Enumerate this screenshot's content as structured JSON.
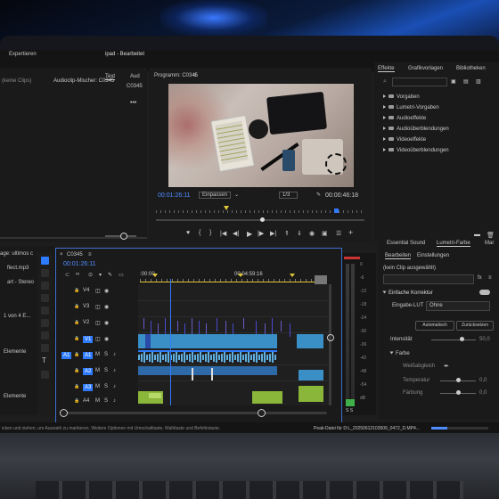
{
  "window": {
    "workspace_tabs": [
      "Expertieren",
      "ipad - Bearbeitet"
    ],
    "left_panel_hint": "(keine Clips)",
    "audio_mixer_label": "Audioclip-Mischer: C0345",
    "text_tab": "Text",
    "aud_tab": "Aud",
    "clip_name": "C0345"
  },
  "program_monitor": {
    "title": "Programm: C0345",
    "timecode_left": "00:01:26:11",
    "fit_option": "Einpassen",
    "resolution": "1/3",
    "timecode_right": "00:00:46:18"
  },
  "effects_panel": {
    "tabs": [
      "Effekte",
      "Grafikvorlagen",
      "Bibliotheken"
    ],
    "items": [
      "Vorgaben",
      "Lumetri-Vorgaben",
      "Audioeffekte",
      "Audioüberblendungen",
      "Videoeffekte",
      "Videoüberblendungen"
    ]
  },
  "timeline": {
    "sequence_name": "C0345",
    "timecode": "00:01:26:11",
    "ruler_marks": [
      ":00:00",
      "00:04:59:16"
    ],
    "video_tracks": [
      "V4",
      "V3",
      "V2",
      "V1"
    ],
    "audio_tracks": [
      "A1",
      "A2",
      "A3",
      "A4"
    ],
    "source_patch": "A1",
    "track_letters": [
      "M",
      "S"
    ]
  },
  "project_panel": {
    "items": [
      "age: ultimos c",
      "flect.mp3",
      "art - Stereo",
      "1 von 4 E...",
      "Elemente",
      "Elemente"
    ]
  },
  "lumetri": {
    "tabs": [
      "Essential Sound",
      "Lumetri-Farbe",
      "Mar"
    ],
    "subtabs": [
      "Bearbeiten",
      "Einstellungen"
    ],
    "no_clip": "(kein Clip ausgewählt)",
    "fx_label": "fx",
    "section_basic": "Einfache Korrektur",
    "input_lut_label": "Eingabe-LUT",
    "input_lut_value": "Ohne",
    "auto_button": "Automatisch",
    "reset_button": "Zurücksetzen",
    "intensity_label": "Intensität",
    "intensity_value": "50,0",
    "color_section": "Farbe",
    "white_balance": "Weißabgleich",
    "temperature": "Temperatur",
    "temperature_value": "0,0",
    "tint": "Färbung",
    "tint_value": "0,0"
  },
  "meter_scale": [
    "0",
    "-6",
    "-12",
    "-18",
    "-24",
    "-30",
    "-36",
    "-42",
    "-48",
    "-54",
    "dB"
  ],
  "status_bar": {
    "left": "icken und ziehen, um Auswahl zu markieren. Weitere Optionen mit Umschalttaste, Wahltaste und Befehlstaste.",
    "right": "Peak-Datei für D:L_20250612103509_0472_D.MP4..."
  },
  "colors": {
    "accent_blue": "#2f7bff",
    "clip_blue": "#3a8fc7",
    "clip_green": "#8ab63a",
    "playhead_yellow": "#e0c83a"
  }
}
